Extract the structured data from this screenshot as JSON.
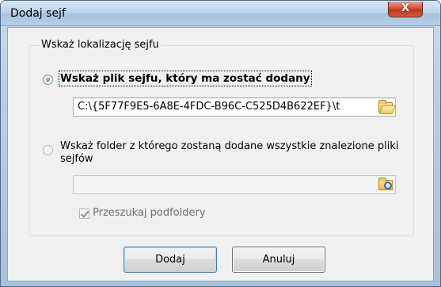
{
  "window": {
    "title": "Dodaj sejf",
    "close_label": "X"
  },
  "group": {
    "legend": "Wskaż lokalizację sejfu"
  },
  "option_file": {
    "label": "Wskaż plik sejfu, który ma zostać dodany",
    "selected": true,
    "path_value": "C:\\{5F77F9E5-6A8E-4FDC-B96C-C525D4B622EF}\\t",
    "browse_icon": "open-folder-icon"
  },
  "option_folder": {
    "label": "Wskaż folder z którego zostaną dodane wszystkie znalezione pliki sejfów",
    "selected": false,
    "path_value": "",
    "browse_icon": "search-folder-icon",
    "subfolders_label": "Przeszukaj podfoldery",
    "subfolders_checked": true
  },
  "buttons": {
    "ok_label": "Dodaj",
    "cancel_label": "Anuluj"
  },
  "colors": {
    "title_bar": "#b6cde5",
    "close_button": "#c0371f",
    "dialog_bg": "#f0f0f0"
  }
}
